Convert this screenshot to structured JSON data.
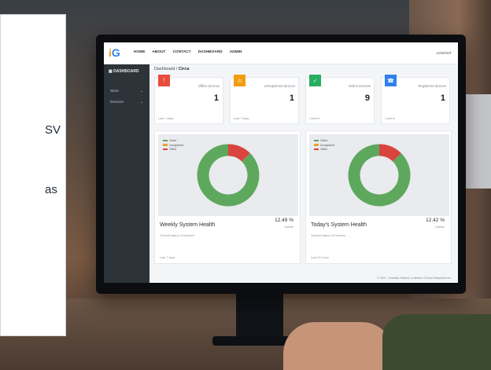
{
  "left_card": {
    "fragment_1": "SV",
    "fragment_2": "as"
  },
  "app": {
    "logo": {
      "letter1": "i",
      "letter2": "G"
    },
    "nav": [
      "HOME",
      "ABOUT",
      "CONTACT",
      "DASHBOARD",
      "ADMIN"
    ],
    "logout": "LOGOUT",
    "sidebar": {
      "title": "DASHBOARD",
      "items": [
        {
          "label": "Sites",
          "chevron": "⌄"
        },
        {
          "label": "Devices",
          "chevron": "⌄"
        }
      ]
    },
    "breadcrumb": {
      "prefix": "Dashboard /",
      "current": "Circa"
    },
    "cards": [
      {
        "icon": "!",
        "title": "Offline devices",
        "value": "1",
        "footer": "Last 7 days",
        "color": "#e74c3c"
      },
      {
        "icon": "⚠",
        "title": "Unregistered devices",
        "value": "1",
        "footer": "Last 7 days",
        "color": "#f39c12"
      },
      {
        "icon": "✓",
        "title": "Online Devices",
        "value": "9",
        "footer": "Current",
        "color": "#27ae60"
      },
      {
        "icon": "☎",
        "title": "Registered devices",
        "value": "1",
        "footer": "Current",
        "color": "#2f80ed"
      }
    ],
    "panels": [
      {
        "title": "Weekly System Health",
        "subtitle": "Overall status of Devices",
        "percent": "12.49 %",
        "percent_label": "Uptime",
        "footer": "Last 7 days",
        "legend": [
          "Online",
          "Unregistered",
          "Offline"
        ],
        "chart_data": {
          "type": "pie",
          "labels": [
            "Online",
            "Unregistered",
            "Offline"
          ],
          "values": [
            87.51,
            0,
            12.49
          ],
          "colors": [
            "#5ea85e",
            "#f0a030",
            "#d9443f"
          ]
        }
      },
      {
        "title": "Today's System Health",
        "subtitle": "Overall status of Devices",
        "percent": "12.42 %",
        "percent_label": "Uptime",
        "footer": "Last 24 hours",
        "legend": [
          "Online",
          "Unregistered",
          "Offline"
        ],
        "chart_data": {
          "type": "pie",
          "labels": [
            "Online",
            "Unregistered",
            "Offline"
          ],
          "values": [
            87.58,
            0,
            12.42
          ],
          "colors": [
            "#5ea85e",
            "#f0a030",
            "#d9443f"
          ]
        }
      }
    ],
    "copyright": "© 2022 - Guardian Telecom, a division of Circa Enterprises Inc."
  }
}
